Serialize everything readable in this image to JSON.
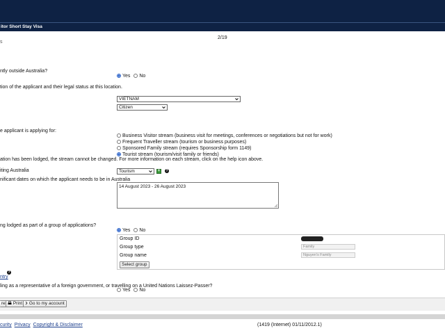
{
  "header": {
    "title": "itor Short Stay Visa",
    "page_counter": "2/19",
    "left_stub": "s"
  },
  "questions": {
    "outside_australia": {
      "label": "ntly outside Australia?",
      "options": [
        "Yes",
        "No"
      ],
      "selected": "Yes"
    },
    "location": {
      "label": "tion of the applicant and their legal status at this location.",
      "country": "VIETNAM",
      "status": "Citizen"
    },
    "stream": {
      "label": "e applicant is applying for:",
      "options": [
        "Business Visitor stream (business visit for meetings, conferences or negotiations but not for work)",
        "Frequent Traveller stream (tourism or business purposes)",
        "Sponsored Family stream (requires Sponsorship form 1149)",
        "Tourist stream (tourism/visit family or friends)"
      ],
      "selected_index": 3,
      "note": "ation has been lodged, the stream cannot be changed. For more information on each stream, click on the help icon above."
    },
    "reason": {
      "label": "iting Australia",
      "value": "Tourism"
    },
    "dates": {
      "label": "nificant dates on which the applicant needs to be in Australia",
      "value": "14 August 2023 - 26 August 2023"
    },
    "group": {
      "label": "ng lodged as part of a group of applications?",
      "options": [
        "Yes",
        "No"
      ],
      "selected": "Yes",
      "id_label": "Group ID",
      "type_label": "Group type",
      "type_value": "Family",
      "name_label": "Group name",
      "name_value": "Nguyen's Family",
      "select_button": "Select group"
    },
    "country_link": "ntry",
    "representative": {
      "label": "ling as a representative of a foreign government, or travelling on a United Nations Laissez-Passer?",
      "options": [
        "Yes",
        "No"
      ]
    }
  },
  "buttons": {
    "save": "re",
    "print": "Print",
    "account": "Go to my account"
  },
  "footer": {
    "links": [
      "curity",
      "Privacy",
      "Copyright & Disclaimer"
    ],
    "version": "(1419 (Internet) 01/11/2012.1)"
  },
  "icons": {
    "help": "help-icon",
    "add": "add-icon",
    "print": "printer-icon",
    "go": "chevron-right-icon"
  }
}
